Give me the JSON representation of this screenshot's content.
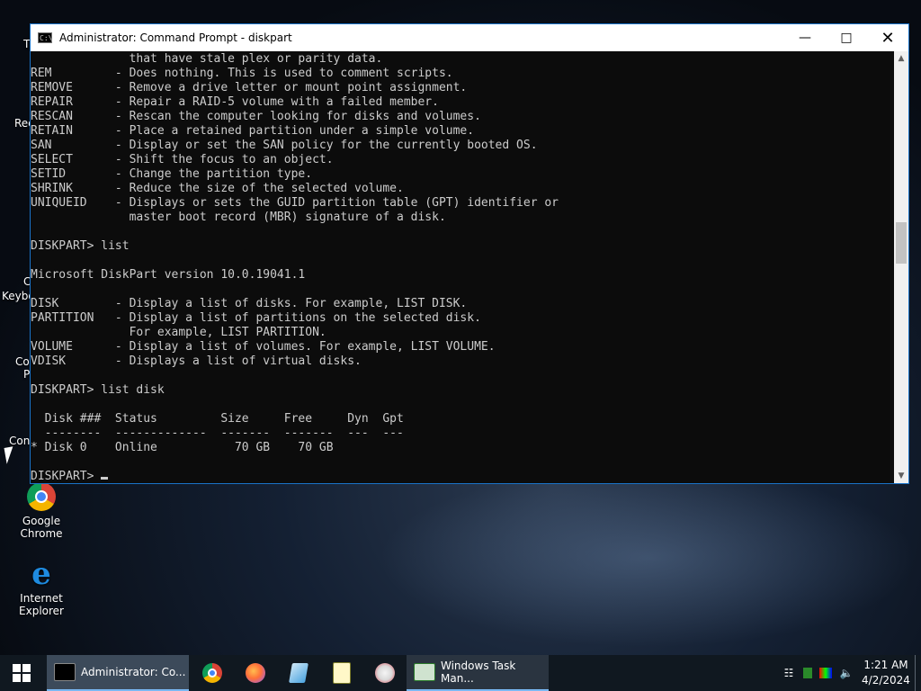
{
  "desktop": {
    "icons": [
      {
        "label": "Google Chrome"
      },
      {
        "label": "Internet Explorer"
      }
    ],
    "partial_labels": [
      "T",
      "Rec",
      "C",
      "Keybo",
      "Co",
      "P",
      "Con"
    ]
  },
  "window": {
    "title": "Administrator: Command Prompt - diskpart",
    "terminal_lines": [
      "              that have stale plex or parity data.",
      "REM         - Does nothing. This is used to comment scripts.",
      "REMOVE      - Remove a drive letter or mount point assignment.",
      "REPAIR      - Repair a RAID-5 volume with a failed member.",
      "RESCAN      - Rescan the computer looking for disks and volumes.",
      "RETAIN      - Place a retained partition under a simple volume.",
      "SAN         - Display or set the SAN policy for the currently booted OS.",
      "SELECT      - Shift the focus to an object.",
      "SETID       - Change the partition type.",
      "SHRINK      - Reduce the size of the selected volume.",
      "UNIQUEID    - Displays or sets the GUID partition table (GPT) identifier or",
      "              master boot record (MBR) signature of a disk.",
      "",
      "DISKPART> list",
      "",
      "Microsoft DiskPart version 10.0.19041.1",
      "",
      "DISK        - Display a list of disks. For example, LIST DISK.",
      "PARTITION   - Display a list of partitions on the selected disk.",
      "              For example, LIST PARTITION.",
      "VOLUME      - Display a list of volumes. For example, LIST VOLUME.",
      "VDISK       - Displays a list of virtual disks.",
      "",
      "DISKPART> list disk",
      "",
      "  Disk ###  Status         Size     Free     Dyn  Gpt",
      "  --------  -------------  -------  -------  ---  ---",
      "* Disk 0    Online           70 GB    70 GB",
      ""
    ],
    "prompt": "DISKPART> "
  },
  "taskbar": {
    "active_task": "Administrator: Co...",
    "other_task": "Windows Task Man...",
    "clock_time": "1:21 AM",
    "clock_date": "4/2/2024"
  }
}
